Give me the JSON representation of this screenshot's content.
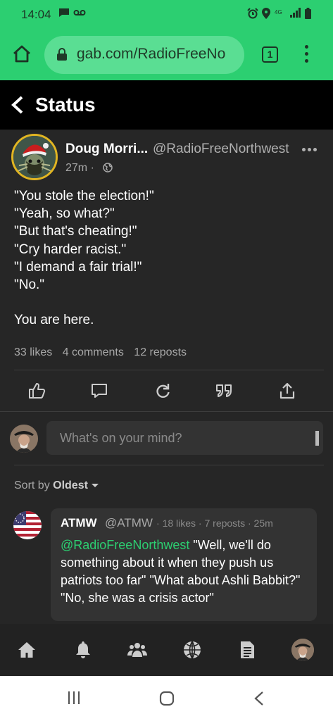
{
  "status_bar": {
    "time": "14:04"
  },
  "browser": {
    "url": "gab.com/RadioFreeNo",
    "tab_count": "1"
  },
  "header": {
    "title": "Status"
  },
  "post": {
    "author_name": "Doug Morri...",
    "author_handle": "@RadioFreeNorthwest",
    "time": "27m",
    "body_lines": [
      "\"You stole the election!\"",
      "\"Yeah, so what?\"",
      "\"But that's cheating!\"",
      "\"Cry harder racist.\"",
      "\"I demand a fair trial!\"",
      "\"No.\"",
      "",
      "You are here."
    ],
    "likes": "33 likes",
    "comments": "4 comments",
    "reposts": "12 reposts",
    "actions": [
      "like-icon",
      "comment-icon",
      "repost-icon",
      "quote-icon",
      "share-icon"
    ]
  },
  "compose": {
    "placeholder": "What's on your mind?"
  },
  "sort": {
    "label": "Sort by",
    "value": "Oldest"
  },
  "comment": {
    "author_name": "ATMW",
    "author_handle": "@ATMW",
    "likes": "18 likes",
    "reposts": "7 reposts",
    "time": "25m",
    "mention": "@RadioFreeNorthwest",
    "text": " \"Well, we'll do something about it when they push us patriots too far\" \"What about Ashli Babbit?\" \"No, she was a crisis actor\""
  },
  "bottom_nav": [
    "home-icon",
    "notifications-icon",
    "groups-icon",
    "explore-icon",
    "news-icon",
    "profile-avatar"
  ],
  "colors": {
    "accent": "#2ccf71",
    "background": "#262626",
    "header": "#000000"
  }
}
